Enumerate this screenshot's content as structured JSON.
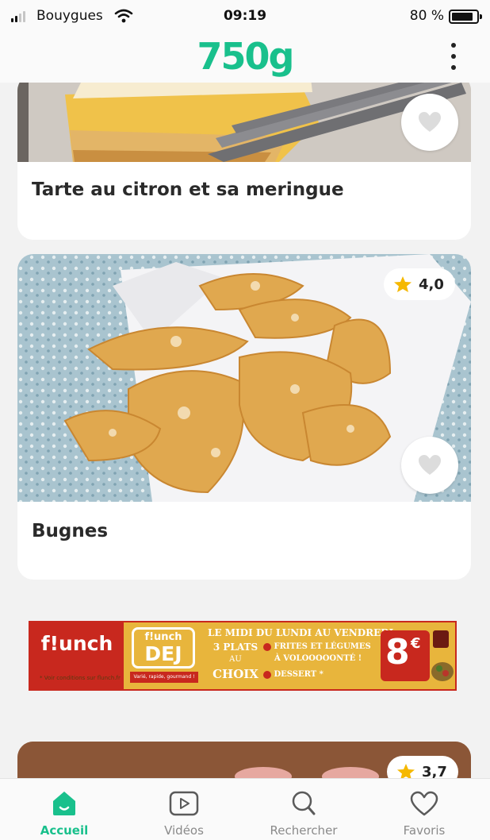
{
  "status_bar": {
    "carrier": "Bouygues",
    "time": "09:19",
    "battery": "80 %",
    "battery_level": 0.8
  },
  "header": {
    "logo": "750g",
    "brand_color": "#19c08c"
  },
  "recipes": [
    {
      "title": "Tarte au citron et sa meringue",
      "rating": null
    },
    {
      "title": "Bugnes",
      "rating": "4,0"
    },
    {
      "title": "",
      "rating": "3,7"
    }
  ],
  "ad": {
    "brand": "f!unch",
    "sub_brand_top": "f!unch",
    "sub_brand": "DEJ",
    "tagline": "Varié, rapide, gourmand !",
    "conditions": "* Voir conditions sur flunch.fr",
    "headline": "LE MIDI DU LUNDI AU VENDREDI",
    "plats_line1": "3 PLATS",
    "plats_line2": "AU",
    "plats_line3": "CHOIX",
    "option_frites": "FRITES ET LÉGUMES",
    "option_volonte": "À VOLOOOOONTÉ !",
    "option_dessert": "DESSERT *",
    "price": "8",
    "currency": "€"
  },
  "tabs": [
    {
      "label": "Accueil",
      "icon": "home-icon",
      "active": true
    },
    {
      "label": "Vidéos",
      "icon": "play-icon",
      "active": false
    },
    {
      "label": "Rechercher",
      "icon": "search-icon",
      "active": false
    },
    {
      "label": "Favoris",
      "icon": "heart-icon",
      "active": false
    }
  ],
  "colors": {
    "accent": "#19c08c",
    "star": "#f5b800",
    "ad_red": "#c8281e",
    "ad_yellow": "#e8b53c"
  }
}
